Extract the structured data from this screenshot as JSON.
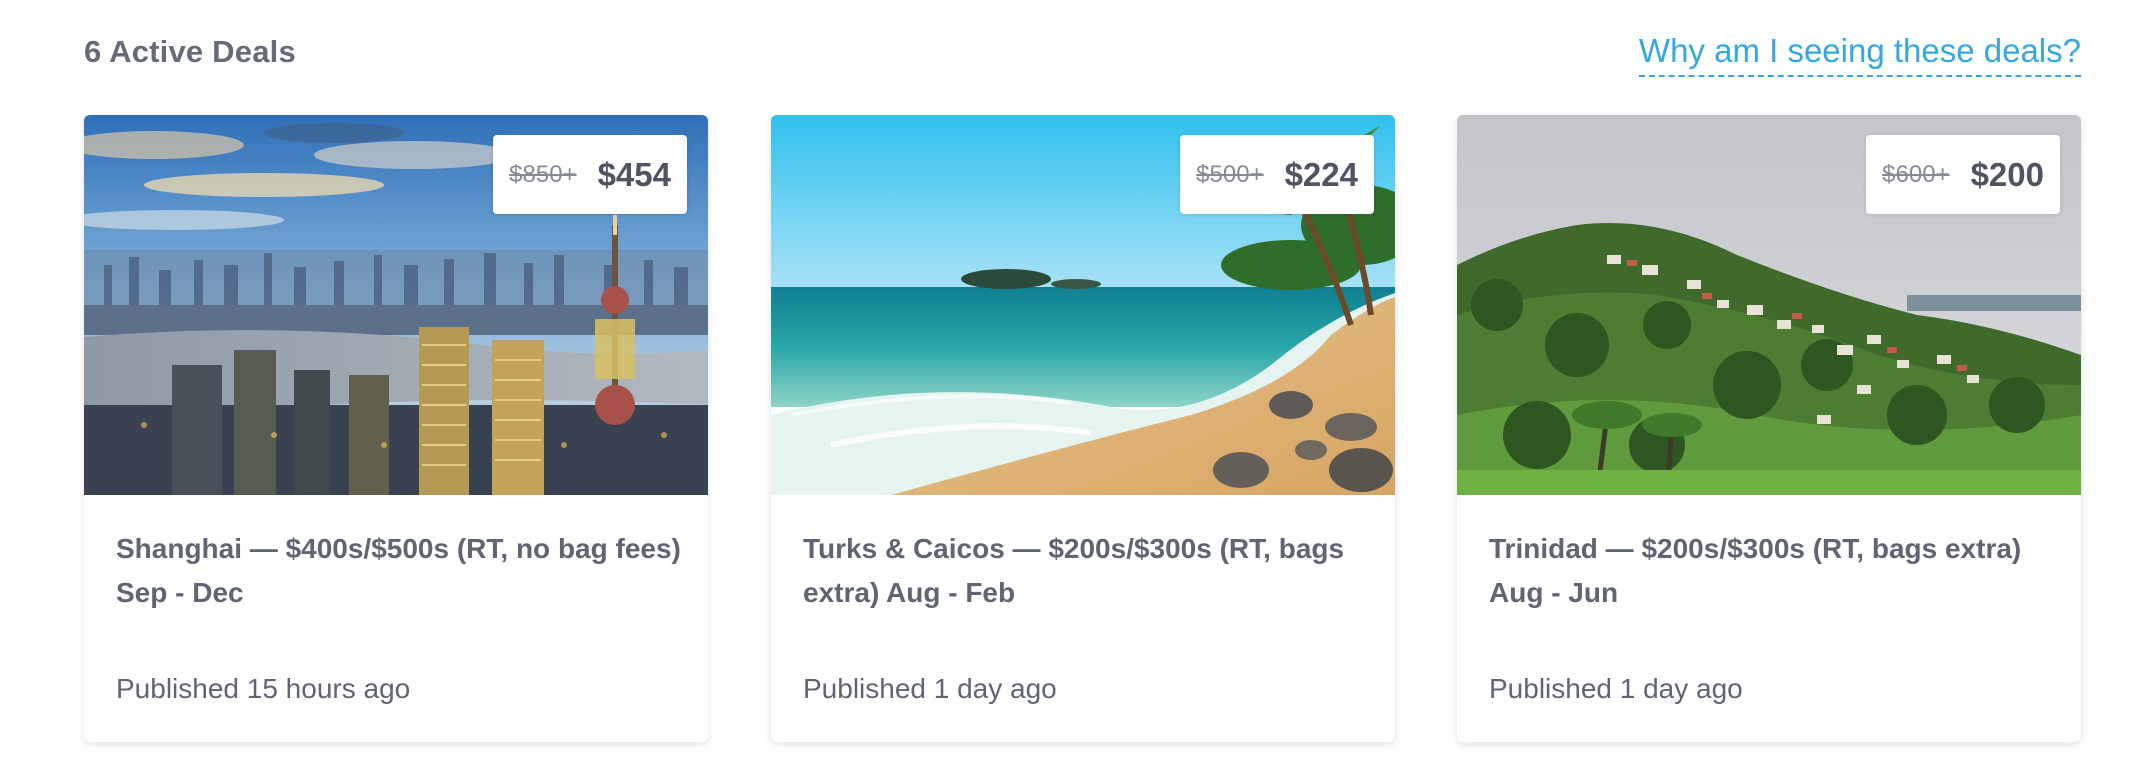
{
  "header": {
    "deals_count": "6 Active Deals",
    "why_link": "Why am I seeing these deals?"
  },
  "colors": {
    "link": "#35a7e3",
    "text": "#5f6572",
    "card_background": "#ffffff"
  },
  "deals": [
    {
      "image_subject": "shanghai-skyline-photo",
      "old_price": "$850+",
      "price": "$454",
      "title": "Shanghai — $400s/$500s (RT, no bag fees) Sep - Dec",
      "published": "Published 15 hours ago"
    },
    {
      "image_subject": "turks-caicos-beach-photo",
      "old_price": "$500+",
      "price": "$224",
      "title": "Turks & Caicos — $200s/$300s (RT, bags extra) Aug - Feb",
      "published": "Published 1 day ago"
    },
    {
      "image_subject": "trinidad-hillside-photo",
      "old_price": "$600+",
      "price": "$200",
      "title": "Trinidad — $200s/$300s (RT, bags extra) Aug - Jun",
      "published": "Published 1 day ago"
    }
  ]
}
